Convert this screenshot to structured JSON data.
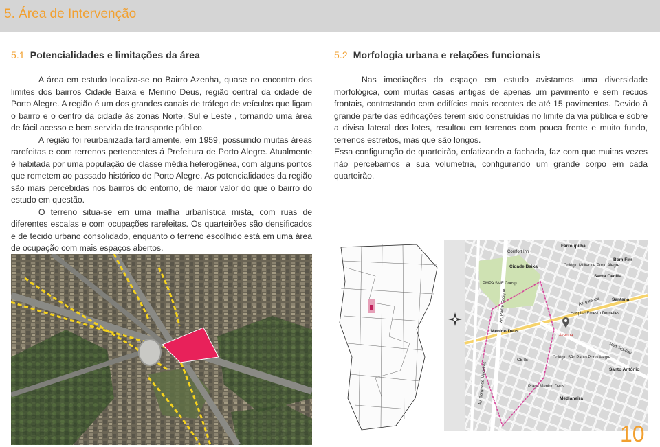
{
  "header": {
    "title": "5. Área de Intervenção"
  },
  "left_section": {
    "number": "5.1",
    "heading": "Potencialidades e limitações da área",
    "paragraphs": [
      "A área em estudo localiza-se no Bairro Azenha, quase no encontro dos limites dos bairros Cidade Baixa e Menino Deus, região central da cidade de Porto Alegre. A região é um dos grandes canais de tráfego de veículos que ligam o bairro e o centro da cidade às zonas Norte, Sul e Leste , tornando uma área de fácil acesso e bem servida de transporte público.",
      "A região foi reurbanizada tardiamente, em 1959, possuindo muitas áreas rarefeitas e com terrenos pertencentes á Prefeitura de Porto Alegre. Atualmente é habitada por uma população de classe média heterogênea, com alguns pontos que remetem ao passado histórico de Porto Alegre. As potencialidades da região são mais percebidas nos bairros do entorno, de maior valor do que o bairro do estudo em questão.",
      "O terreno situa-se em uma malha urbanística mista, com ruas de diferentes escalas e com ocupações rarefeitas. Os quarteirões são densificados e de tecido urbano consolidado, enquanto o terreno escolhido está em uma área de ocupação com mais espaços abertos."
    ]
  },
  "right_section": {
    "number": "5.2",
    "heading": "Morfologia urbana e relações funcionais",
    "paragraphs": [
      "Nas imediações do espaço em estudo avistamos uma diversidade morfológica, com muitas casas antigas de apenas um pavimento e sem recuos frontais, contrastando com edifícios mais recentes de até 15 pavimentos. Devido à grande parte das edificações terem sido construídas no limite da via pública e sobre a divisa lateral dos lotes, resultou em terrenos com pouca frente e muito fundo, terrenos estreitos, mas que são longos.",
      "Essa configuração de quarteirão, enfatizando a fachada, faz com que muitas vezes não percebamos a sua volumetria, configurando um grande corpo em cada quarteirão."
    ]
  },
  "map_labels": {
    "farroupilha": "Farroupilha",
    "comfort_inn": "Comfort Inn",
    "cidade_baixa": "Cidade Baixa",
    "colegio_militar": "Colégio Militar de Porto Alegre",
    "bom_fim": "Bom Fim",
    "santa_cecilia": "Santa Cecília",
    "pmpa": "PMPA SMF Coesp",
    "santana": "Santana",
    "av_ipiranga": "Av. Ipiranga",
    "hospital": "Hospital Ernesto Dornelles",
    "menino_deus": "Menino Deus",
    "azenha": "Azenha",
    "rs_040": "Rod. RS-040",
    "colegio_santa_clara": "Colégio São Paulo Porto Alegre",
    "santo_antonio": "Santo Antônio",
    "praca_menino_deus": "Praça Menino Deus",
    "medianeira": "Medianeira",
    "cete": "CETE",
    "av_borges": "Av. Borges de Medeiros",
    "av_padre": "Av. Padre Cacique"
  },
  "page_number": "10",
  "colors": {
    "accent": "#f2a02f",
    "header_bg": "#d5d5d5",
    "site_pink": "#e8215a"
  }
}
